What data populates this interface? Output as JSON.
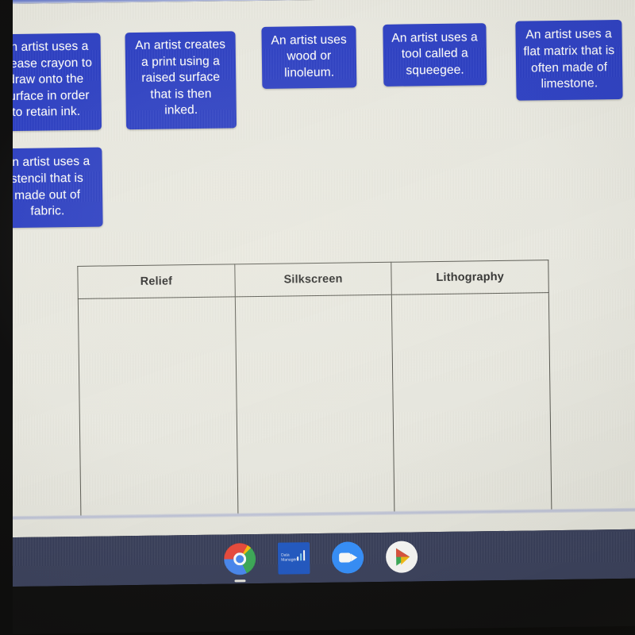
{
  "activity": {
    "cards": [
      {
        "id": "card-grease-crayon",
        "text": "An artist uses a grease crayon to draw onto the surface in order to retain ink."
      },
      {
        "id": "card-raised-surface",
        "text": "An artist creates a print using a raised surface that is then inked."
      },
      {
        "id": "card-wood-linoleum",
        "text": "An artist uses wood or linoleum."
      },
      {
        "id": "card-squeegee",
        "text": "An artist uses a tool called a squeegee."
      },
      {
        "id": "card-flat-matrix",
        "text": "An artist uses a flat matrix that is often made of limestone."
      },
      {
        "id": "card-stencil-fabric",
        "text": "An artist uses a stencil that is made out of fabric."
      }
    ],
    "table": {
      "headers": [
        "Relief",
        "Silkscreen",
        "Lithography"
      ],
      "rows": [
        [
          "",
          "",
          ""
        ]
      ]
    }
  },
  "shelf": {
    "items": [
      {
        "name": "chrome-icon",
        "label": "Google Chrome"
      },
      {
        "name": "data-app-icon",
        "label": "Data",
        "label2": "Manager"
      },
      {
        "name": "zoom-icon",
        "label": "Zoom"
      },
      {
        "name": "google-play-icon",
        "label": "Play Store"
      }
    ]
  },
  "colors": {
    "card_blue": "#1c31c3",
    "page_bg": "#e9e9e2",
    "shelf_bg": "#2b3252",
    "top_bar_blue": "#1a35b8",
    "table_border": "#4d4d46"
  }
}
